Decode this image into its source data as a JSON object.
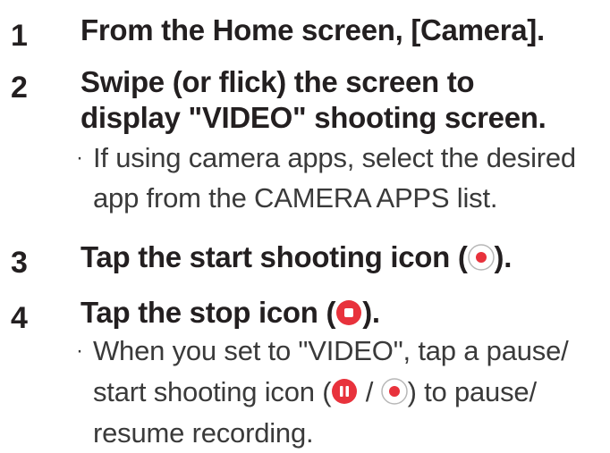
{
  "steps": [
    {
      "number": "1",
      "title": "From the Home screen, [Camera]."
    },
    {
      "number": "2",
      "title_lines": [
        "Swipe (or flick) the screen to",
        "display \"VIDEO\" shooting screen."
      ],
      "note_lines": [
        "If using camera apps, select the desired",
        "app from the CAMERA APPS list."
      ]
    },
    {
      "number": "3",
      "title_pre": "Tap the start shooting icon (",
      "title_post": ")."
    },
    {
      "number": "4",
      "title_pre": "Tap the stop icon (",
      "title_post": ").",
      "note_line1": "When you set to \"VIDEO\", tap a pause/",
      "note_line2_pre": "start shooting icon (",
      "note_line2_sep": " / ",
      "note_line2_post": ") to pause/",
      "note_line3": "resume recording."
    }
  ],
  "bullet_char": "·",
  "icons": {
    "start_shooting": "record-start-icon",
    "stop": "record-stop-icon",
    "pause": "pause-icon"
  },
  "colors": {
    "record_red": "#e8323c",
    "text": "#231f20"
  }
}
